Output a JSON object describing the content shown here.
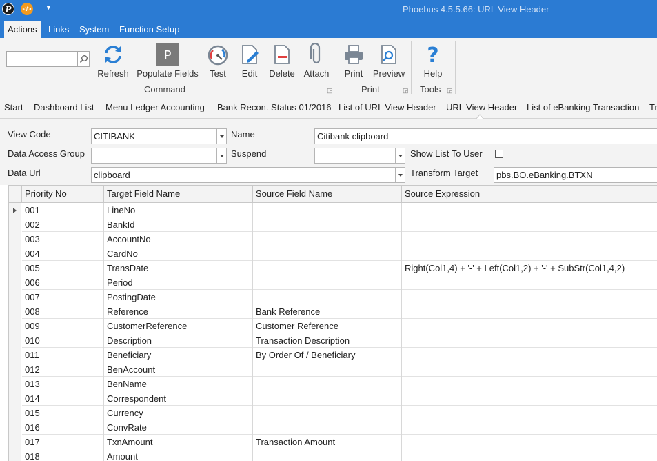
{
  "window": {
    "title": "Phoebus 4.5.5.66: URL View Header"
  },
  "menu": {
    "items": [
      "Actions",
      "Links",
      "System",
      "Function Setup"
    ]
  },
  "ribbon": {
    "search": {
      "value": ""
    },
    "buttons": {
      "refresh": "Refresh",
      "populate_fields": "Populate Fields",
      "test": "Test",
      "edit": "Edit",
      "delete": "Delete",
      "attach": "Attach",
      "print": "Print",
      "preview": "Preview",
      "help": "Help"
    },
    "groups": {
      "command": "Command",
      "print": "Print",
      "tools": "Tools"
    }
  },
  "tabs": [
    "Start",
    "Dashboard List",
    "Menu Ledger Accounting",
    "Bank Recon. Status 01/2016",
    "List of URL View Header",
    "URL View Header",
    "List of eBanking Transaction",
    "Tr"
  ],
  "form": {
    "view_code": {
      "label": "View Code",
      "value": "CITIBANK"
    },
    "name": {
      "label": "Name",
      "value": "Citibank clipboard"
    },
    "data_access_group": {
      "label": "Data Access Group",
      "value": ""
    },
    "suspend": {
      "label": "Suspend",
      "value": ""
    },
    "show_list_to_user": {
      "label": "Show List To User"
    },
    "data_url": {
      "label": "Data Url",
      "value": "clipboard"
    },
    "transform_target": {
      "label": "Transform Target",
      "value": "pbs.BO.eBanking.BTXN"
    }
  },
  "grid": {
    "columns": [
      "Priority No",
      "Target Field Name",
      "Source Field Name",
      "Source Expression"
    ],
    "rows": [
      [
        "001",
        "LineNo",
        "",
        ""
      ],
      [
        "002",
        "BankId",
        "",
        ""
      ],
      [
        "003",
        "AccountNo",
        "",
        ""
      ],
      [
        "004",
        "CardNo",
        "",
        ""
      ],
      [
        "005",
        "TransDate",
        "",
        "Right(Col1,4) + '-' + Left(Col1,2) + '-' + SubStr(Col1,4,2)"
      ],
      [
        "006",
        "Period",
        "",
        ""
      ],
      [
        "007",
        "PostingDate",
        "",
        ""
      ],
      [
        "008",
        "Reference",
        "Bank Reference",
        ""
      ],
      [
        "009",
        "CustomerReference",
        "Customer Reference",
        ""
      ],
      [
        "010",
        "Description",
        "Transaction Description",
        ""
      ],
      [
        "011",
        "Beneficiary",
        "By Order Of / Beneficiary",
        ""
      ],
      [
        "012",
        "BenAccount",
        "",
        ""
      ],
      [
        "013",
        "BenName",
        "",
        ""
      ],
      [
        "014",
        "Correspondent",
        "",
        ""
      ],
      [
        "015",
        "Currency",
        "",
        ""
      ],
      [
        "016",
        "ConvRate",
        "",
        ""
      ],
      [
        "017",
        "TxnAmount",
        "Transaction Amount",
        ""
      ],
      [
        "018",
        "Amount",
        "",
        ""
      ]
    ]
  }
}
